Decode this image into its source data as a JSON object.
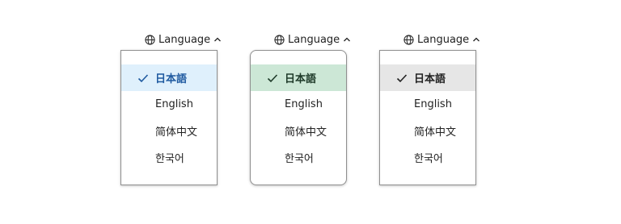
{
  "language_menus": [
    {
      "trigger_label": "Language",
      "selected_bg": "#dff0fc",
      "selected_color": "#1f5aa0",
      "items": [
        "日本語",
        "English",
        "简体中文",
        "한국어"
      ]
    },
    {
      "trigger_label": "Language",
      "selected_bg": "#cce7d6",
      "selected_color": "#1e3a29",
      "items": [
        "日本語",
        "English",
        "简体中文",
        "한국어"
      ]
    },
    {
      "trigger_label": "Language",
      "selected_bg": "#e6e6e6",
      "selected_color": "#222222",
      "items": [
        "日本語",
        "English",
        "简体中文",
        "한국어"
      ]
    }
  ],
  "icons": {
    "trigger_leading": "globe-icon",
    "trigger_trailing": "chevron-up-icon",
    "selected_marker": "check-icon"
  }
}
